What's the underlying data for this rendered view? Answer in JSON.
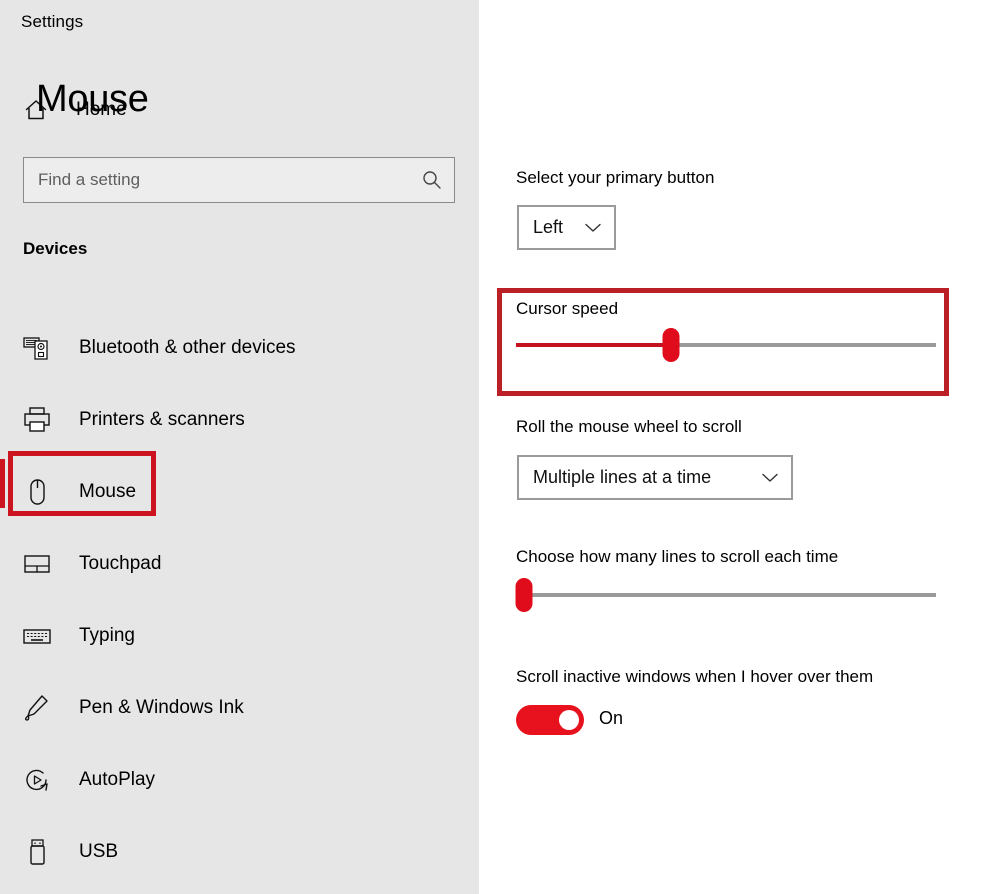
{
  "app": {
    "title": "Settings"
  },
  "sidebar": {
    "home": {
      "label": "Home",
      "icon": "home-icon"
    },
    "search": {
      "placeholder": "Find a setting",
      "value": "",
      "icon": "search-icon"
    },
    "group_heading": "Devices",
    "items": [
      {
        "label": "Bluetooth & other devices",
        "icon": "bluetooth-devices-icon",
        "selected": false
      },
      {
        "label": "Printers & scanners",
        "icon": "printer-icon",
        "selected": false
      },
      {
        "label": "Mouse",
        "icon": "mouse-icon",
        "selected": true
      },
      {
        "label": "Touchpad",
        "icon": "touchpad-icon",
        "selected": false
      },
      {
        "label": "Typing",
        "icon": "keyboard-icon",
        "selected": false
      },
      {
        "label": "Pen & Windows Ink",
        "icon": "pen-icon",
        "selected": false
      },
      {
        "label": "AutoPlay",
        "icon": "autoplay-icon",
        "selected": false
      },
      {
        "label": "USB",
        "icon": "usb-icon",
        "selected": false
      }
    ]
  },
  "main": {
    "page_title": "Mouse",
    "primary_button": {
      "label": "Select your primary button",
      "value": "Left",
      "chevron": "chevron-down-icon"
    },
    "cursor_speed": {
      "label": "Cursor speed",
      "value_percent": 37
    },
    "scroll_mode": {
      "label": "Roll the mouse wheel to scroll",
      "value": "Multiple lines at a time",
      "chevron": "chevron-down-icon"
    },
    "scroll_lines": {
      "label": "Choose how many lines to scroll each time",
      "value_percent": 2
    },
    "scroll_inactive": {
      "label": "Scroll inactive windows when I hover over them",
      "state_label": "On",
      "checked": true
    }
  },
  "annotations": {
    "highlight_color": "#cc1421",
    "cursor_speed_box_color": "#bb2026",
    "accent_red": "#e8121f"
  }
}
